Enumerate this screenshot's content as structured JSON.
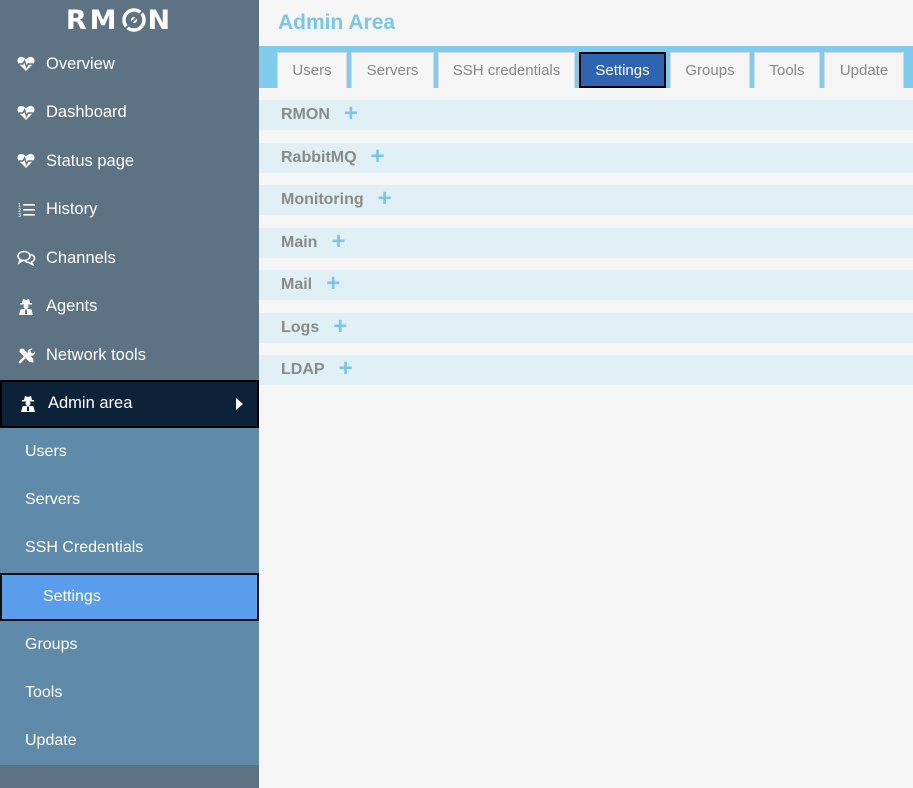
{
  "app": {
    "logo": "RMON",
    "logo_left": "RM",
    "logo_right": "N"
  },
  "sidebar": {
    "items": [
      {
        "label": "Overview",
        "icon": "heart-pulse-icon"
      },
      {
        "label": "Dashboard",
        "icon": "heart-pulse-icon"
      },
      {
        "label": "Status page",
        "icon": "heart-pulse-icon"
      },
      {
        "label": "History",
        "icon": "list-icon"
      },
      {
        "label": "Channels",
        "icon": "chat-icon"
      },
      {
        "label": "Agents",
        "icon": "agent-icon"
      },
      {
        "label": "Network tools",
        "icon": "tools-icon"
      },
      {
        "label": "Admin area",
        "icon": "agent-icon",
        "active": true
      }
    ],
    "submenu": [
      {
        "label": "Users"
      },
      {
        "label": "Servers"
      },
      {
        "label": "SSH Credentials"
      },
      {
        "label": "Settings",
        "active": true
      },
      {
        "label": "Groups"
      },
      {
        "label": "Tools"
      },
      {
        "label": "Update"
      }
    ]
  },
  "main": {
    "title": "Admin Area",
    "tabs": [
      {
        "label": "Users"
      },
      {
        "label": "Servers"
      },
      {
        "label": "SSH credentials"
      },
      {
        "label": "Settings",
        "active": true
      },
      {
        "label": "Groups"
      },
      {
        "label": "Tools"
      },
      {
        "label": "Update"
      }
    ],
    "sections": [
      {
        "label": "RMON",
        "expand": "+"
      },
      {
        "label": "RabbitMQ",
        "expand": "+"
      },
      {
        "label": "Monitoring",
        "expand": "+"
      },
      {
        "label": "Main",
        "expand": "+"
      },
      {
        "label": "Mail",
        "expand": "+"
      },
      {
        "label": "Logs",
        "expand": "+"
      },
      {
        "label": "LDAP",
        "expand": "+"
      }
    ]
  },
  "colors": {
    "sidebar_bg": "#5d7282",
    "submenu_bg": "#5f8aaa",
    "active_menu_bg": "#0b2239",
    "active_sub_bg": "#5b9ded",
    "accent": "#7ecbed",
    "active_tab_bg": "#2f64b2",
    "section_bg": "#dfeff3"
  }
}
